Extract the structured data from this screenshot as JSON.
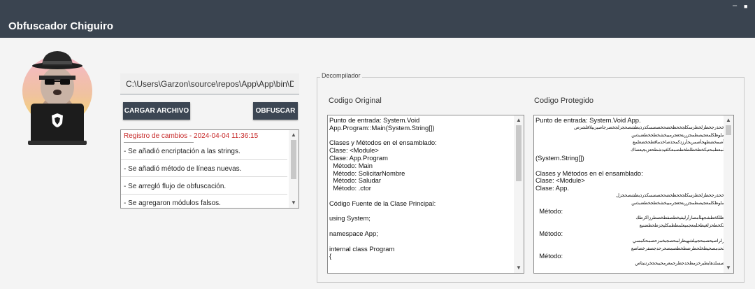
{
  "window": {
    "title": "Obfuscador Chiguiro",
    "minimize_glyph": "–",
    "maximize_glyph": "■"
  },
  "colors": {
    "titlebar": "#3a4450",
    "button": "#3c4653",
    "log_header": "#c62828"
  },
  "avatar": {
    "icon": "hacker-capybara-avatar-icon"
  },
  "loader": {
    "path_value": "C:\\Users\\Garzon\\source\\repos\\App\\App\\bin\\De",
    "load_button": "CARGAR ARCHIVO",
    "obfuscate_button": "OBFUSCAR"
  },
  "changelog": {
    "header": "Registro de cambios - 2024-04-04 11:36:15",
    "items": [
      "- Se añadió encriptación a las strings.",
      "- Se añadió método de líneas nuevas.",
      "- Se arregló flujo de obfuscación.",
      "- Se agregaron módulos falsos."
    ]
  },
  "decompiler": {
    "group_label": "Decompilador",
    "original_title": "Codigo Original",
    "protected_title": "Codigo Protegido",
    "original_code": [
      "Punto de entrada: System.Void App.Program::Main(System.String[])",
      "",
      "Clases y Métodos en el ensamblado:",
      "Clase: <Module>",
      "Clase: App.Program",
      "  Método: Main",
      "  Método: SolicitarNombre",
      "  Método: Saludar",
      "  Método: .ctor",
      "",
      "Código Fuente de la Clase Principal:",
      "",
      "using System;",
      "",
      "namespace App;",
      "",
      "internal class Program",
      "{"
    ],
    "protected_code": [
      {
        "t": "Punto de entrada: System.Void App."
      },
      {
        "t": "خحذرجخظزلخظزسكلجخحظخضحخصضسكذرذيظشصحجزلجخضرجاصيزبيلاقلشزص",
        "s": true
      },
      {
        "t": "ملوظكلمعجيصطمجزريتحعجرمبيخشخطجخطضبذس",
        "s": true
      },
      {
        "t": "أصمخضطهحأصمريحأرزدكمحذصاخدماقطحخضعلمع",
        "s": true
      },
      {
        "t": "لمعطمحنيكخظخطلطخطضمعكلغيدشطحعزبجيعصاك",
        "s": true
      },
      {
        "t": "(System.String[])"
      },
      {
        "t": ""
      },
      {
        "t": "Clases y Métodos en el ensamblado:"
      },
      {
        "t": "Clase: <Module>"
      },
      {
        "t": "Clase: App."
      },
      {
        "t": "خحذرجخظزلخظزسكلجخحظخضحخصضسكذرذيظشصحجزل",
        "s": true
      },
      {
        "t": "ملوظكلمعجيصطمجزريتحعجرمبيخشخطجخطضبذس",
        "s": true
      },
      {
        "t": "  Método:"
      },
      {
        "t": "ظلكخطشجهلأمصارأرليفيخطصفطخصطرزاكرطك",
        "s": true
      },
      {
        "t": "لكخطحزلغيظحلمعجميعلمطظمكليجزطحظضنيع",
        "s": true
      },
      {
        "t": "  Método:"
      },
      {
        "t": "رلراصيحصمحجبيلشهيظرلمحصجبخمزحصمحكمسي",
        "s": true
      },
      {
        "t": "لحدمصحيطخلحطرضطخطصمضحرحدجصفرخضاصع",
        "s": true
      },
      {
        "t": "  Método:"
      },
      {
        "t": "صسلدهايطبرخزمطحدجطرجمعرمحيبحجخرتنبتاص",
        "s": true
      }
    ]
  }
}
